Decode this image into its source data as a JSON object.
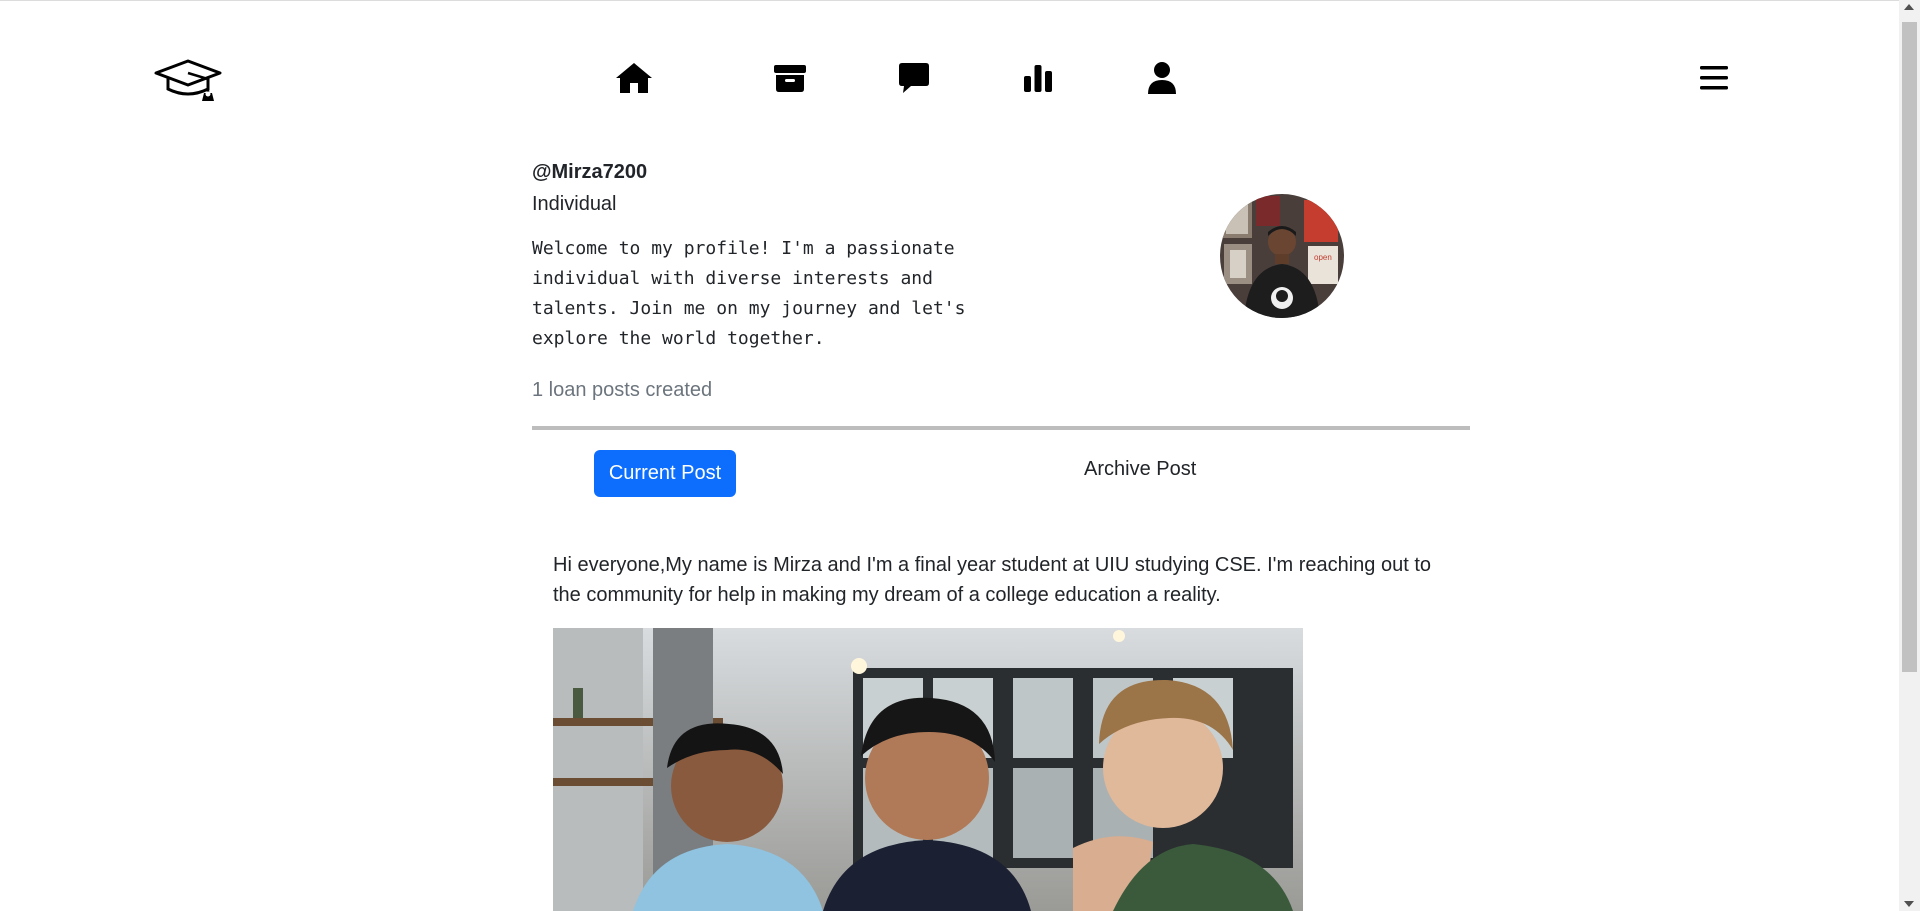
{
  "nav": {
    "logo_icon": "graduation-cap-icon",
    "items": [
      {
        "icon": "home-icon"
      },
      {
        "icon": "archive-icon"
      },
      {
        "icon": "message-icon"
      },
      {
        "icon": "chart-bar-icon"
      },
      {
        "icon": "user-icon"
      }
    ],
    "menu_icon": "hamburger-menu-icon"
  },
  "profile": {
    "username": "@Mirza7200",
    "type": "Individual",
    "bio": "Welcome to my profile! I'm a passionate individual with diverse interests and talents. Join me on my journey and let's explore the world together.",
    "post_count": "1 loan posts created"
  },
  "tabs": {
    "current": "Current Post",
    "archive": "Archive Post"
  },
  "post": {
    "text": "Hi everyone,My name is Mirza and I'm a final year student at UIU studying CSE. I'm reaching out to the community for help in making my dream of a college education a reality."
  },
  "colors": {
    "primary": "#0d6efd",
    "muted": "#6c757d",
    "divider": "#bdbdbd"
  }
}
